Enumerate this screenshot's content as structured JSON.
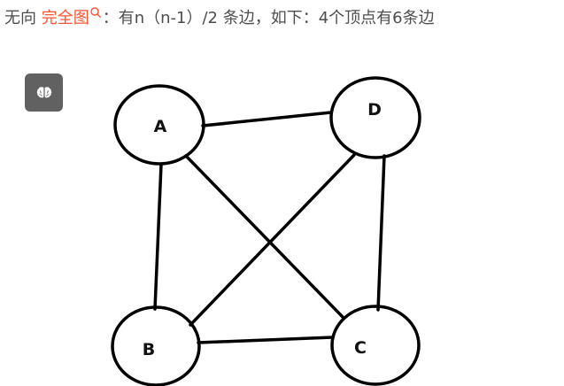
{
  "caption": {
    "prefix": "无向 ",
    "link_text": "完全图",
    "suffix": "：有n（n-1）/2 条边，如下：4个顶点有6条边"
  },
  "tool_button": {
    "icon": "brain-icon"
  },
  "diagram": {
    "nodes": [
      {
        "id": "A",
        "label": "A"
      },
      {
        "id": "D",
        "label": "D"
      },
      {
        "id": "B",
        "label": "B"
      },
      {
        "id": "C",
        "label": "C"
      }
    ],
    "edges": [
      {
        "from": "A",
        "to": "D"
      },
      {
        "from": "A",
        "to": "B"
      },
      {
        "from": "A",
        "to": "C"
      },
      {
        "from": "D",
        "to": "B"
      },
      {
        "from": "D",
        "to": "C"
      },
      {
        "from": "B",
        "to": "C"
      }
    ]
  },
  "colors": {
    "text": "#4d4d4d",
    "link": "#fc5531",
    "button_bg": "#616161",
    "stroke": "#000000"
  }
}
